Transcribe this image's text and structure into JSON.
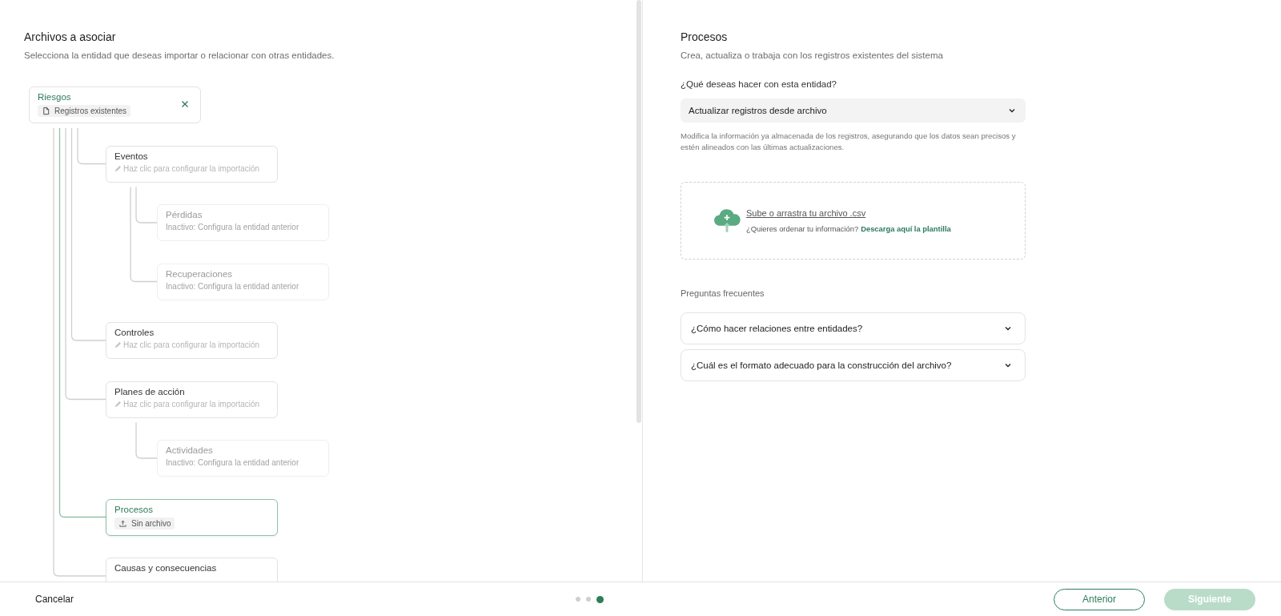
{
  "left_panel": {
    "title": "Archivos a asociar",
    "subtitle": "Selecciona la entidad que deseas importar o relacionar con otras entidades."
  },
  "tree": {
    "title": "Riesgos",
    "kind": "configured",
    "selected": false,
    "chip": {
      "kind": "existing",
      "text": "Registros existentes"
    },
    "closable": true,
    "children": [
      {
        "title": "Eventos",
        "kind": "pending",
        "selected": false,
        "hint": "Haz clic para configurar la importación",
        "children": [
          {
            "title": "Pérdidas",
            "kind": "inactive",
            "selected": false,
            "hint": "Inactivo: Configura la entidad anterior"
          },
          {
            "title": "Recuperaciones",
            "kind": "inactive",
            "selected": false,
            "hint": "Inactivo: Configura la entidad anterior"
          }
        ]
      },
      {
        "title": "Controles",
        "kind": "pending",
        "selected": false,
        "hint": "Haz clic para configurar la importación"
      },
      {
        "title": "Planes de acción",
        "kind": "pending",
        "selected": false,
        "hint": "Haz clic para configurar la importación",
        "children": [
          {
            "title": "Actividades",
            "kind": "inactive",
            "selected": false,
            "hint": "Inactivo: Configura la entidad anterior"
          }
        ]
      },
      {
        "title": "Procesos",
        "kind": "configured",
        "selected": true,
        "chip": {
          "kind": "missing",
          "text": "Sin archivo"
        }
      },
      {
        "title": "Causas y consecuencias",
        "kind": "pending",
        "selected": false
      }
    ]
  },
  "right_panel": {
    "title": "Procesos",
    "subtitle": "Crea, actualiza o trabaja con los registros existentes del sistema",
    "question": "¿Qué deseas hacer con esta entidad?",
    "select_value": "Actualizar registros desde archivo",
    "description": "Modifica la información ya almacenada de los registros, asegurando que los datos sean precisos y estén alineados con las últimas actualizaciones.",
    "upload": {
      "link": "Sube o arrastra tu archivo .csv",
      "hint": "¿Quieres ordenar tu información?",
      "template_link": "Descarga aquí la plantilla"
    },
    "faq_title": "Preguntas frecuentes",
    "faq": [
      {
        "question": "¿Cómo hacer relaciones entre entidades?",
        "expanded": false
      },
      {
        "question": "¿Cuál es el formato adecuado para la construcción del archivo?",
        "expanded": false
      }
    ]
  },
  "footer": {
    "cancel": "Cancelar",
    "steps": [
      {
        "selected": false
      },
      {
        "selected": false
      },
      {
        "selected": true
      }
    ],
    "back": "Anterior",
    "next": "Siguiente",
    "next_disabled": true
  }
}
